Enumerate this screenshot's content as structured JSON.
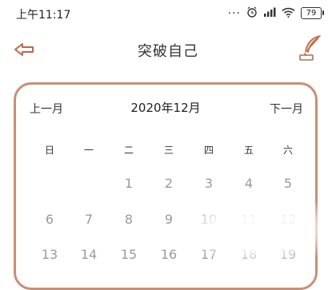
{
  "status_bar": {
    "time": "上午11:17",
    "dots": "···",
    "battery": "79"
  },
  "header": {
    "title": "突破自己"
  },
  "calendar": {
    "prev_label": "上一月",
    "next_label": "下一月",
    "month_title": "2020年12月",
    "weekdays": [
      "日",
      "一",
      "二",
      "三",
      "四",
      "五",
      "六"
    ],
    "rows": [
      [
        "",
        "",
        "1",
        "2",
        "3",
        "4",
        "5"
      ],
      [
        "6",
        "7",
        "8",
        "9",
        "10",
        "11",
        "12"
      ],
      [
        "13",
        "14",
        "15",
        "16",
        "17",
        "18",
        "19"
      ]
    ]
  },
  "colors": {
    "card_border": "#c98f77",
    "day_text": "#9a9a9a"
  }
}
